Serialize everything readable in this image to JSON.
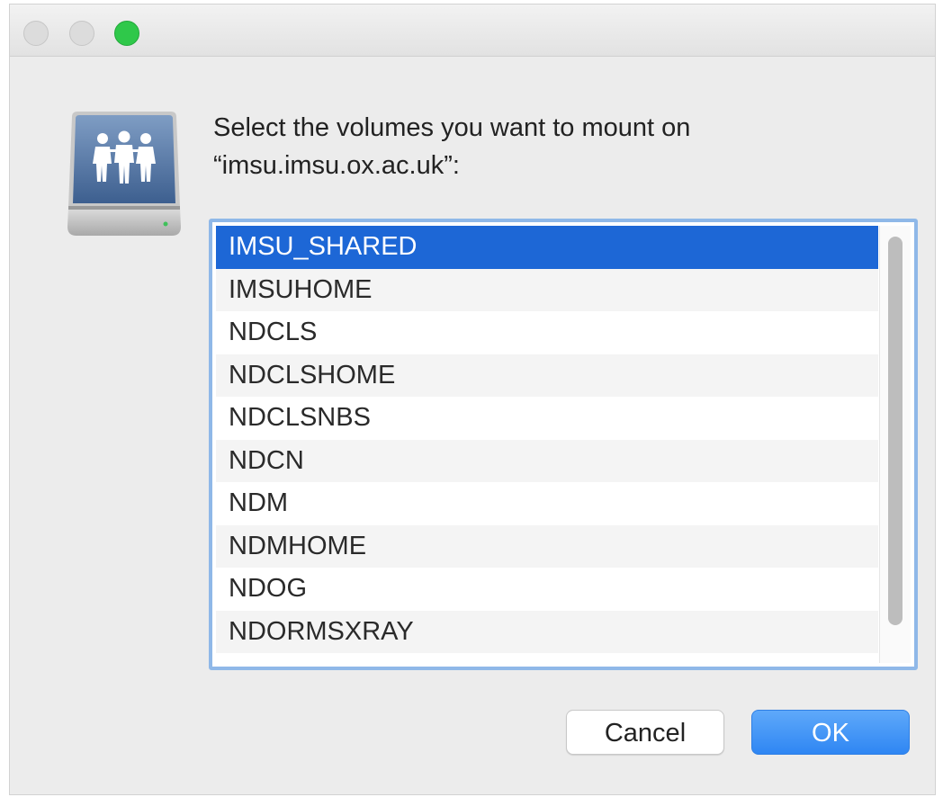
{
  "window": {
    "controls": {
      "close_color": "#dcdcdc",
      "minimize_color": "#dcdcdc",
      "zoom_color": "#2fc84a"
    }
  },
  "dialog": {
    "icon": "network-drive-icon",
    "prompt_line1": "Select the volumes you want to mount on",
    "prompt_line2": "“imsu.imsu.ox.ac.uk”:",
    "volumes": [
      "IMSU_SHARED",
      "IMSUHOME",
      "NDCLS",
      "NDCLSHOME",
      "NDCLSNBS",
      "NDCN",
      "NDM",
      "NDMHOME",
      "NDOG",
      "NDORMSXRAY"
    ],
    "selected_volume": "IMSU_SHARED",
    "cancel_label": "Cancel",
    "ok_label": "OK"
  },
  "colors": {
    "selection": "#1d67d6",
    "ok_button": "#2f86f3",
    "focus_ring": "#8fb8e8"
  }
}
